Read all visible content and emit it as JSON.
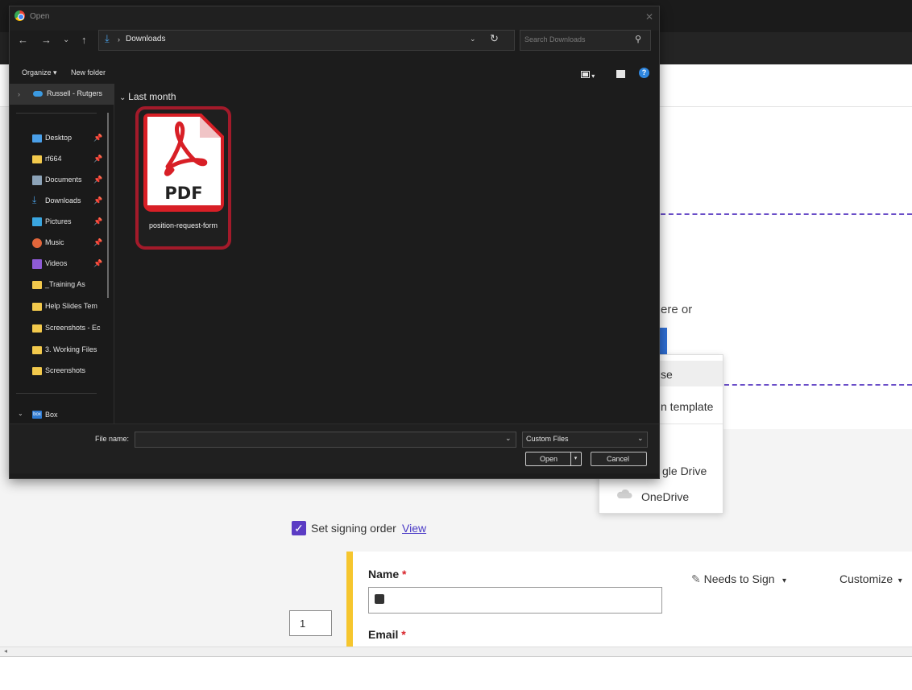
{
  "dialog": {
    "title": "Open",
    "address_folder": "Downloads",
    "search_placeholder": "Search Downloads",
    "organize_label": "Organize ▾",
    "new_folder_label": "New folder",
    "group_header": "Last month",
    "file": {
      "name": "position-request-form",
      "type_badge": "PDF"
    },
    "nav_items": [
      {
        "label": "Russell - Rutgers",
        "icon": "onedrive-cloud-icon",
        "color": "#3b9ae1"
      },
      {
        "label": "Desktop",
        "icon": "desktop-icon",
        "color": "#4a9fe8"
      },
      {
        "label": "rf664",
        "icon": "folder-icon",
        "color": "#f2c94c"
      },
      {
        "label": "Documents",
        "icon": "documents-icon",
        "color": "#8ca3b8"
      },
      {
        "label": "Downloads",
        "icon": "downloads-icon",
        "color": "#4aa0e6"
      },
      {
        "label": "Pictures",
        "icon": "pictures-icon",
        "color": "#3aa6e0"
      },
      {
        "label": "Music",
        "icon": "music-icon",
        "color": "#e2663b"
      },
      {
        "label": "Videos",
        "icon": "videos-icon",
        "color": "#8e5bd6"
      },
      {
        "label": "_Training As",
        "icon": "folder-icon",
        "color": "#f2c94c"
      },
      {
        "label": "Help Slides Tem",
        "icon": "folder-icon",
        "color": "#f2c94c"
      },
      {
        "label": "Screenshots - Ec",
        "icon": "folder-icon",
        "color": "#f2c94c"
      },
      {
        "label": "3. Working Files",
        "icon": "folder-icon",
        "color": "#f2c94c"
      },
      {
        "label": "Screenshots",
        "icon": "folder-icon",
        "color": "#f2c94c"
      },
      {
        "label": "Box",
        "icon": "box-icon",
        "color": "#2e7ad1"
      }
    ],
    "filename_label": "File name:",
    "filename_value": "",
    "filetype_value": "Custom Files",
    "open_label": "Open",
    "cancel_label": "Cancel"
  },
  "page": {
    "drop_text": "ere or",
    "menu_items": [
      "se",
      "n template",
      "gle Drive",
      "OneDrive"
    ],
    "signing_order_label": "Set signing order",
    "view_link": "View",
    "recipient": {
      "name_label": "Name",
      "email_label": "Email",
      "required_mark": "*",
      "role_label": "Needs to Sign",
      "customize_label": "Customize",
      "order_number": "1"
    }
  },
  "colors": {
    "pdf_red": "#d81f26",
    "selection_ring": "#a31a2a",
    "accent_purple": "#5b3cc4",
    "recipient_stripe": "#f6c62e"
  }
}
